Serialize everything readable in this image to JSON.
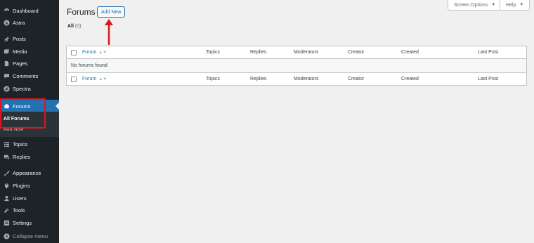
{
  "sidebar": {
    "items": [
      {
        "label": "Dashboard",
        "icon": "dashboard-icon"
      },
      {
        "label": "Astra",
        "icon": "astra-icon"
      },
      {
        "label": "Posts",
        "icon": "pin-icon"
      },
      {
        "label": "Media",
        "icon": "media-icon"
      },
      {
        "label": "Pages",
        "icon": "pages-icon"
      },
      {
        "label": "Comments",
        "icon": "comments-icon"
      },
      {
        "label": "Spectra",
        "icon": "spectra-icon"
      },
      {
        "label": "Forums",
        "icon": "forums-icon"
      },
      {
        "label": "Topics",
        "icon": "topics-icon"
      },
      {
        "label": "Replies",
        "icon": "replies-icon"
      },
      {
        "label": "Appearance",
        "icon": "appearance-icon"
      },
      {
        "label": "Plugins",
        "icon": "plugins-icon"
      },
      {
        "label": "Users",
        "icon": "users-icon"
      },
      {
        "label": "Tools",
        "icon": "tools-icon"
      },
      {
        "label": "Settings",
        "icon": "settings-icon"
      }
    ],
    "submenu": {
      "all_forums": "All Forums",
      "add_new": "Add New"
    },
    "collapse": "Collapse menu",
    "active_color": "#2271b1",
    "highlight_color": "#e0151a"
  },
  "topbar": {
    "screen_options": "Screen Options",
    "help": "Help"
  },
  "header": {
    "title": "Forums",
    "add_new": "Add New"
  },
  "filter": {
    "label": "All",
    "count": "(0)"
  },
  "table": {
    "columns": [
      "Forum",
      "Topics",
      "Replies",
      "Moderators",
      "Creator",
      "Created",
      "Last Post"
    ],
    "empty_message": "No forums found"
  }
}
